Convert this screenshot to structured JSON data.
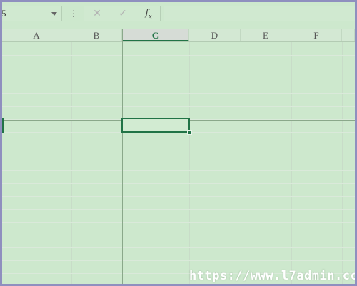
{
  "formula_bar": {
    "name_box": {
      "value": "5"
    },
    "menu_dots": "⋮",
    "cancel_glyph": "✕",
    "enter_glyph": "✓",
    "fx_label": "f",
    "fx_sub": "x",
    "formula_value": ""
  },
  "columns": [
    {
      "label": "A",
      "selected": false
    },
    {
      "label": "B",
      "selected": false
    },
    {
      "label": "C",
      "selected": true
    },
    {
      "label": "D",
      "selected": false
    },
    {
      "label": "E",
      "selected": false
    },
    {
      "label": "F",
      "selected": false
    },
    {
      "label": "",
      "selected": false
    }
  ],
  "active_cell": {
    "column": "C"
  },
  "watermark": "https://www.l7admin.cc",
  "colors": {
    "sheet_background": "#cde8cd",
    "accent": "#217346",
    "frame": "#8f8fbf"
  },
  "icons": {
    "dropdown": "chevron-down-icon",
    "cancel": "close-icon",
    "enter": "check-icon",
    "function": "fx-icon"
  }
}
